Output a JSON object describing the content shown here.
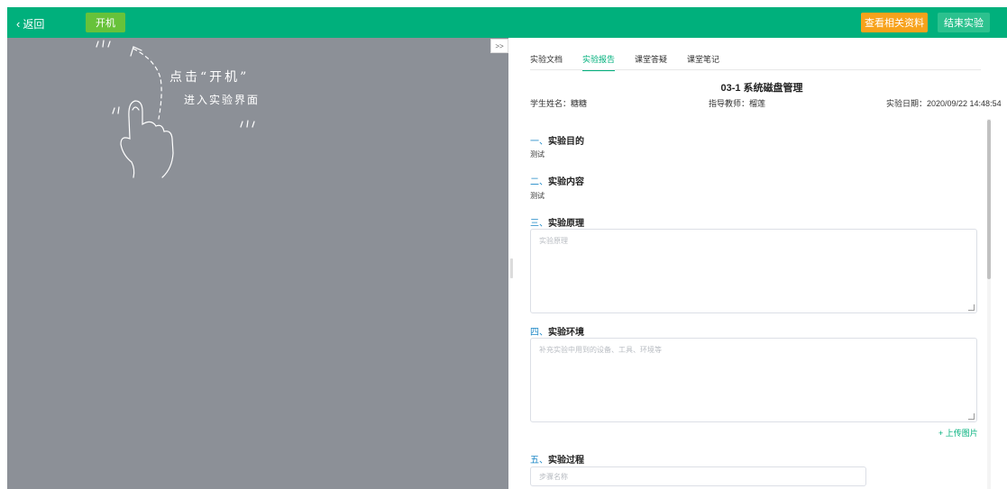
{
  "topbar": {
    "back_label": "返回",
    "boot_label": "开机",
    "view_materials_label": "查看相关资料",
    "end_experiment_label": "结束实验",
    "colors": {
      "bar": "#00b07c",
      "boot": "#67c23a",
      "orange": "#f7a21b"
    }
  },
  "vm": {
    "hint_line1": "点击“开机”",
    "hint_line2": "进入实验界面",
    "icon": "hand-pointer-icon"
  },
  "collapse_label": ">>",
  "tabs": [
    {
      "label": "实验文档",
      "active": false
    },
    {
      "label": "实验报告",
      "active": true
    },
    {
      "label": "课堂答疑",
      "active": false
    },
    {
      "label": "课堂笔记",
      "active": false
    }
  ],
  "report": {
    "title": "03-1 系统磁盘管理",
    "student": "学生姓名：糖糖",
    "teacher": "指导教师：榴莲",
    "date": "实验日期：2020/09/22 14:48:54"
  },
  "sections": {
    "s1_num": "一、",
    "s1_title": "实验目的",
    "s1_text": "测试",
    "s2_num": "二、",
    "s2_title": "实验内容",
    "s2_text": "测试",
    "s3_num": "三、",
    "s3_title": "实验原理",
    "s3_placeholder": "实验原理",
    "s4_num": "四、",
    "s4_title": "实验环境",
    "s4_placeholder": "补充实验中用到的设备、工具、环境等",
    "upload_label": "+ 上传图片",
    "s5_num": "五、",
    "s5_title": "实验过程",
    "step_placeholder": "步骤名称"
  }
}
